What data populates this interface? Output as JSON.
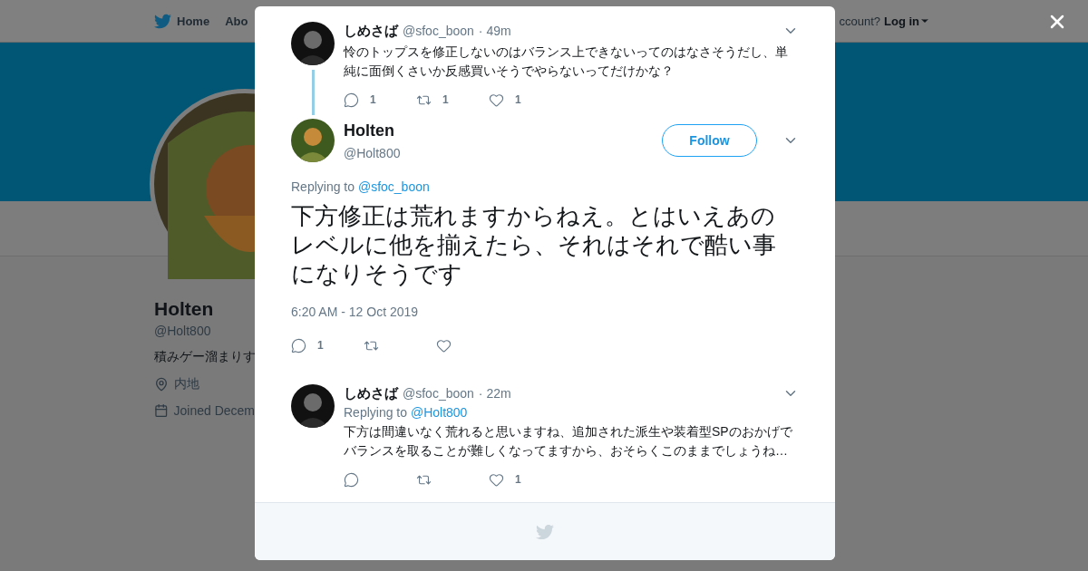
{
  "nav": {
    "items": [
      {
        "label": "Home",
        "kind": "home"
      },
      {
        "label": "Abo",
        "kind": "plain"
      }
    ],
    "account_prompt": "ccount?",
    "login": "Log in"
  },
  "profile": {
    "name": "Holten",
    "handle": "@Holt800",
    "bio": "積みゲー溜まりす",
    "location": "内地",
    "joined": "Joined Decem"
  },
  "modal": {
    "parent_tweet": {
      "name": "しめさば",
      "handle": "@sfoc_boon",
      "time": "· 49m",
      "text": "怜のトップスを修正しないのはバランス上できないってのはなさそうだし、単純に面倒くさいか反感買いそうでやらないってだけかな？",
      "actions": [
        {
          "kind": "reply",
          "count": "1"
        },
        {
          "kind": "retweet",
          "count": "1"
        },
        {
          "kind": "like",
          "count": "1"
        }
      ]
    },
    "main_tweet": {
      "name": "Holten",
      "handle": "@Holt800",
      "follow": "Follow",
      "replying_label": "Replying to",
      "replying_to": "@sfoc_boon",
      "text": "下方修正は荒れますからねえ。とはいえあのレベルに他を揃えたら、それはそれで酷い事になりそうです",
      "date": "6:20 AM - 12 Oct 2019",
      "actions": [
        {
          "kind": "reply",
          "count": "1"
        },
        {
          "kind": "retweet"
        },
        {
          "kind": "like"
        }
      ]
    },
    "replies": [
      {
        "name": "しめさば",
        "handle": "@sfoc_boon",
        "time": "· 22m",
        "replying_label": "Replying to",
        "replying_to": "@Holt800",
        "text": "下方は間違いなく荒れると思いますね、追加された派生や装着型SPのおかげでバランスを取ることが難しくなってますから、おそらくこのままでしょうね…",
        "actions": [
          {
            "kind": "reply"
          },
          {
            "kind": "retweet"
          },
          {
            "kind": "like",
            "count": "1"
          }
        ]
      }
    ]
  }
}
